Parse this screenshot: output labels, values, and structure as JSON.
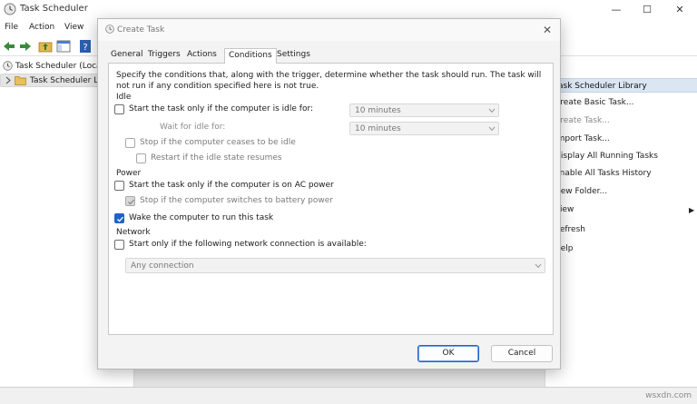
{
  "main_window": {
    "title": "Task Scheduler",
    "controls": {
      "minimize": "—",
      "maximize": "☐",
      "close": "✕"
    },
    "menu": [
      "File",
      "Action",
      "View"
    ],
    "tree": [
      {
        "label": "Task Scheduler (Local)",
        "selected": false
      },
      {
        "label": "Task Scheduler Library",
        "selected": true
      }
    ],
    "actions": {
      "header": "Task Scheduler Library",
      "items": [
        {
          "label": "Create Basic Task...",
          "dim": false
        },
        {
          "label": "Create Task...",
          "dim": true
        },
        {
          "label": "Import Task...",
          "dim": false
        },
        {
          "label": "Display All Running Tasks",
          "dim": false
        },
        {
          "label": "Enable All Tasks History",
          "dim": false
        },
        {
          "label": "New Folder...",
          "dim": false
        },
        {
          "label": "View",
          "dim": false,
          "submenu": true
        },
        {
          "label": "Refresh",
          "dim": false
        },
        {
          "label": "Help",
          "dim": false
        }
      ]
    }
  },
  "dialog": {
    "title": "Create Task",
    "close": "✕",
    "tabs": [
      {
        "label": "General",
        "active": false
      },
      {
        "label": "Triggers",
        "active": false
      },
      {
        "label": "Actions",
        "active": false
      },
      {
        "label": "Conditions",
        "active": true
      },
      {
        "label": "Settings",
        "active": false
      }
    ],
    "description": "Specify the conditions that, along with the trigger, determine whether the task should run.  The task will not run  if any condition specified here is not true.",
    "sections": {
      "idle": "Idle",
      "power": "Power",
      "network": "Network"
    },
    "idle": {
      "start_if_idle": {
        "label": "Start the task only if the computer is idle for:",
        "checked": false
      },
      "idle_for_value": "10 minutes",
      "wait_label": "Wait for idle for:",
      "wait_value": "10 minutes",
      "stop_if_not_idle": {
        "label": "Stop if the computer ceases to be idle",
        "checked": false
      },
      "restart_if_idle": {
        "label": "Restart if the idle state resumes",
        "checked": false
      }
    },
    "power": {
      "ac_power": {
        "label": "Start the task only if the computer is on AC power",
        "checked": false
      },
      "battery_stop": {
        "label": "Stop if the computer switches to battery power",
        "checked": true
      },
      "wake": {
        "label": "Wake the computer to run this task",
        "checked": true
      }
    },
    "network": {
      "start_if_network": {
        "label": "Start only if the following network connection is available:",
        "checked": false
      },
      "connection_value": "Any connection"
    },
    "buttons": {
      "ok": "OK",
      "cancel": "Cancel"
    }
  },
  "watermark": "wsxdn.com",
  "colors": {
    "accent": "#1f63c7",
    "actions_header": "#dbe6f3"
  }
}
